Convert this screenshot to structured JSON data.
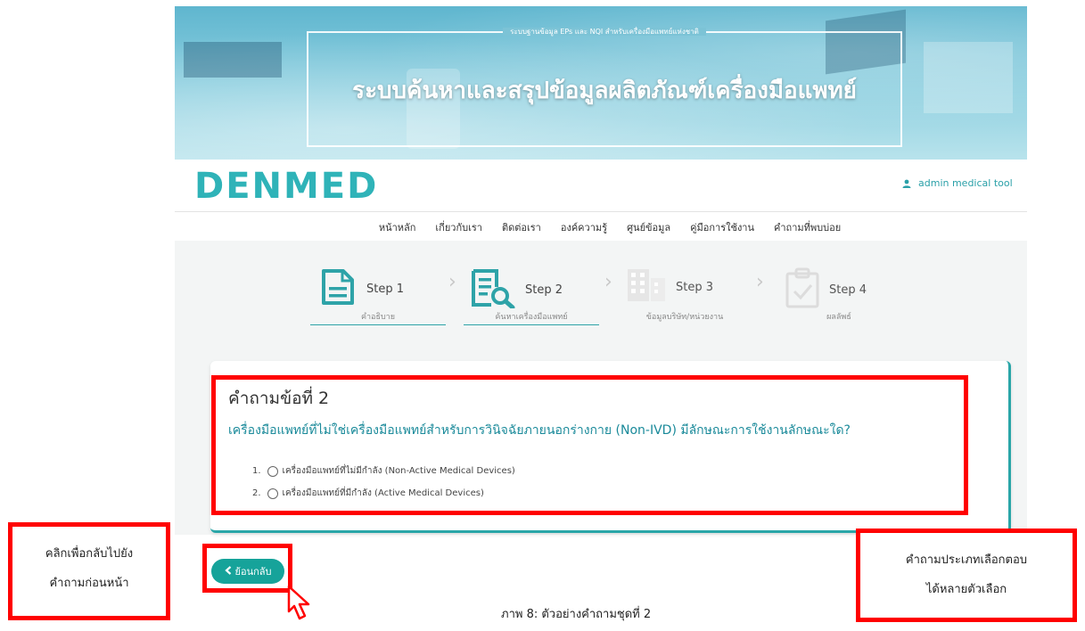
{
  "banner": {
    "subtitle": "ระบบฐานข้อมูล EPs และ NQI สำหรับเครื่องมือแพทย์แห่งชาติ",
    "title": "ระบบค้นหาและสรุปข้อมูลผลิตภัณฑ์เครื่องมือแพทย์"
  },
  "logo": "DENMED",
  "user": {
    "name": "admin medical tool",
    "icon": "person-icon"
  },
  "nav": [
    "หน้าหลัก",
    "เกี่ยวกับเรา",
    "ติดต่อเรา",
    "องค์ความรู้",
    "ศูนย์ข้อมูล",
    "คู่มือการใช้งาน",
    "คำถามที่พบบ่อย"
  ],
  "steps": [
    {
      "label": "Step 1",
      "sub": "คำอธิบาย",
      "icon": "document-icon"
    },
    {
      "label": "Step 2",
      "sub": "ค้นหาเครื่องมือแพทย์",
      "icon": "document-search-icon"
    },
    {
      "label": "Step 3",
      "sub": "ข้อมูลบริษัท/หน่วยงาน",
      "icon": "building-icon"
    },
    {
      "label": "Step 4",
      "sub": "ผลลัพธ์",
      "icon": "clipboard-check-icon"
    }
  ],
  "question": {
    "number": "คำถามข้อที่ 2",
    "text": "เครื่องมือแพทย์ที่ไม่ใช่เครื่องมือแพทย์สำหรับการวินิจฉัยภายนอกร่างกาย (Non-IVD) มีลักษณะการใช้งานลักษณะใด?",
    "options": [
      {
        "num": "1.",
        "label": "เครื่องมือแพทย์ที่ไม่มีกำลัง (Non-Active Medical Devices)"
      },
      {
        "num": "2.",
        "label": "เครื่องมือแพทย์ที่มีกำลัง (Active Medical Devices)"
      }
    ]
  },
  "back_button": "ย้อนกลับ",
  "callout_left": [
    "คลิกเพื่อกลับไปยัง",
    "คำถามก่อนหน้า"
  ],
  "callout_right": [
    "คำถามประเภทเลือกตอบ",
    "ได้หลายตัวเลือก"
  ],
  "caption": "ภาพ 8: ตัวอย่างคำถามชุดที่ 2",
  "colors": {
    "accent": "#2fb3b8",
    "button": "#16a39a",
    "highlight": "#ff0000"
  }
}
